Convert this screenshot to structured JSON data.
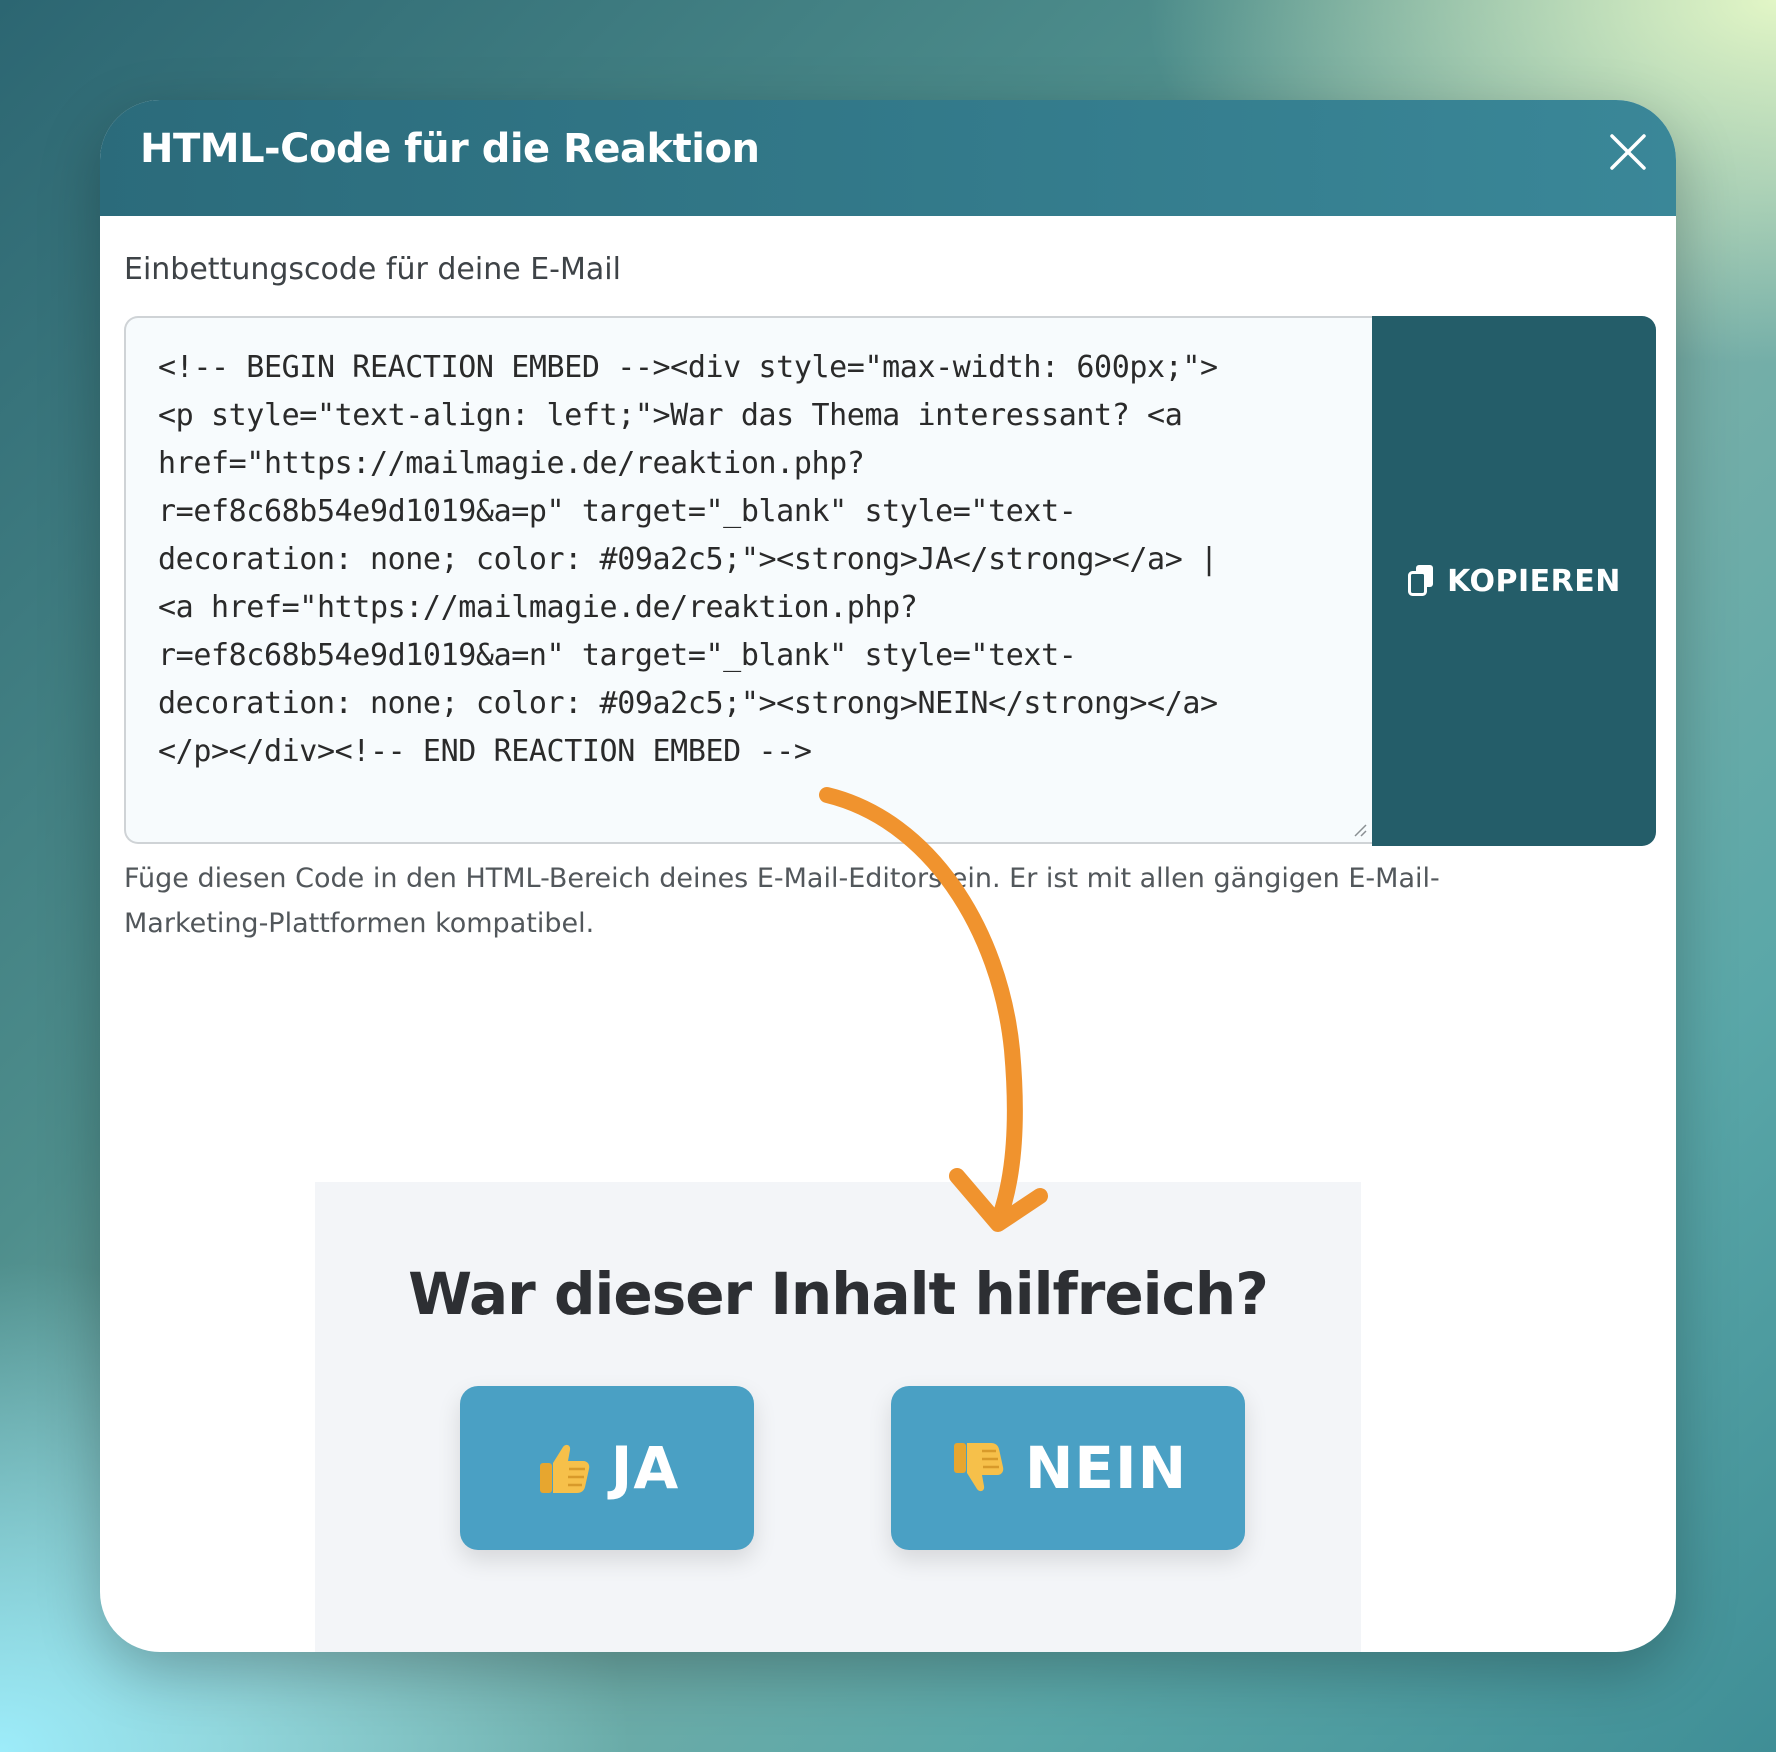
{
  "modal": {
    "title": "HTML-Code für die Reaktion",
    "close_icon": "close-icon"
  },
  "embed": {
    "label": "Einbettungscode für deine E-Mail",
    "code": "<!-- BEGIN REACTION EMBED --><div style=\"max-width: 600px;\">\n<p style=\"text-align: left;\">War das Thema interessant? <a\nhref=\"https://mailmagie.de/reaktion.php?\nr=ef8c68b54e9d1019&a=p\" target=\"_blank\" style=\"text-\ndecoration: none; color: #09a2c5;\"><strong>JA</strong></a> |\n<a href=\"https://mailmagie.de/reaktion.php?\nr=ef8c68b54e9d1019&a=n\" target=\"_blank\" style=\"text-\ndecoration: none; color: #09a2c5;\"><strong>NEIN</strong></a>\n</p></div><!-- END REACTION EMBED -->",
    "copy_label": "KOPIEREN",
    "copy_icon": "copy-icon",
    "help": "Füge diesen Code in den HTML-Bereich deines E-Mail-Editors ein. Er ist mit allen gängigen E-Mail-Marketing-Plattformen kompatibel."
  },
  "preview": {
    "question": "War dieser Inhalt hilfreich?",
    "yes_label": "JA",
    "yes_icon": "thumbs-up-icon",
    "no_label": "NEIN",
    "no_icon": "thumbs-down-icon"
  },
  "colors": {
    "header": "#2b6b7b",
    "copy_button": "#245d69",
    "vote_button": "#4aa0c4",
    "arrow": "#f0932e"
  }
}
